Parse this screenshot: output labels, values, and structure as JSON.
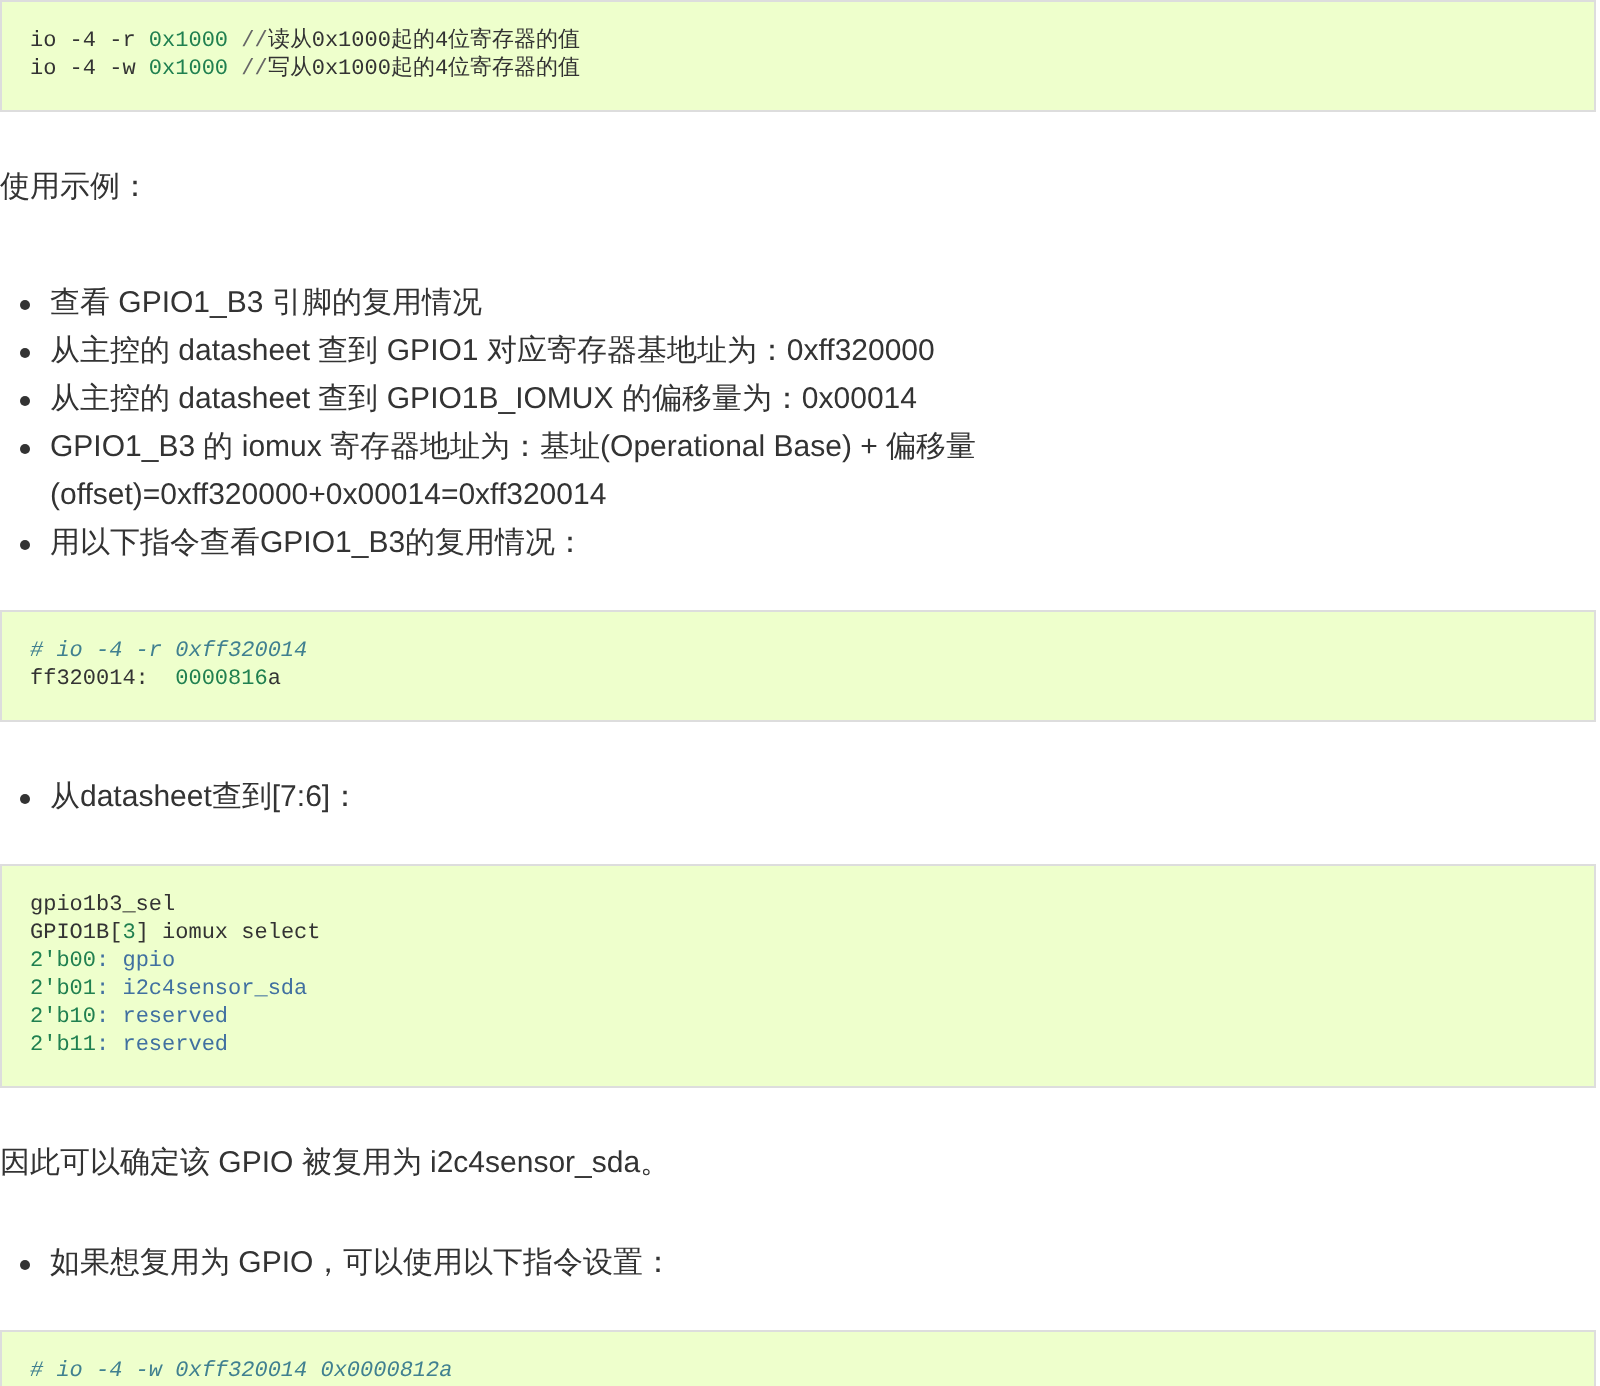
{
  "blocks": [
    {
      "kind": "code",
      "lines": [
        [
          {
            "kind": "plain",
            "text": "io -4 -r "
          },
          {
            "kind": "number",
            "text": "0x1000"
          },
          {
            "kind": "operator",
            "text": " //"
          },
          {
            "kind": "plain",
            "text": "读从0x1000起的4位寄存器的值"
          }
        ],
        [
          {
            "kind": "plain",
            "text": "io -4 -w "
          },
          {
            "kind": "number",
            "text": "0x1000"
          },
          {
            "kind": "operator",
            "text": " //"
          },
          {
            "kind": "plain",
            "text": "写从0x1000起的4位寄存器的值"
          }
        ]
      ]
    },
    {
      "kind": "paragraph",
      "text": "使用示例："
    },
    {
      "kind": "list",
      "items": [
        {
          "text": "查看 GPIO1_B3 引脚的复用情况"
        },
        {
          "text": "从主控的 datasheet 查到 GPIO1 对应寄存器基地址为：0xff320000"
        },
        {
          "text": "从主控的 datasheet 查到 GPIO1B_IOMUX 的偏移量为：0x00014"
        },
        {
          "text": "GPIO1_B3 的 iomux 寄存器地址为：基址(Operational Base) + 偏移量(offset)=0xff320000+0x00014=0xff320014"
        },
        {
          "text": "用以下指令查看GPIO1_B3的复用情况："
        }
      ]
    },
    {
      "kind": "code",
      "lines": [
        [
          {
            "kind": "comment",
            "text": "# io -4 -r 0xff320014"
          }
        ],
        [
          {
            "kind": "plain",
            "text": "ff320014:  "
          },
          {
            "kind": "number",
            "text": "0000816"
          },
          {
            "kind": "plain",
            "text": "a"
          }
        ]
      ]
    },
    {
      "kind": "list",
      "items": [
        {
          "text": "从datasheet查到[7:6]："
        }
      ]
    },
    {
      "kind": "code",
      "lines": [
        [
          {
            "kind": "plain",
            "text": "gpio1b3_sel"
          }
        ],
        [
          {
            "kind": "plain",
            "text": "GPIO1B["
          },
          {
            "kind": "number",
            "text": "3"
          },
          {
            "kind": "plain",
            "text": "] iomux select"
          }
        ],
        [
          {
            "kind": "number",
            "text": "2'b00"
          },
          {
            "kind": "name",
            "text": ": gpio"
          }
        ],
        [
          {
            "kind": "number",
            "text": "2'b01"
          },
          {
            "kind": "name",
            "text": ": i2c4sensor_sda"
          }
        ],
        [
          {
            "kind": "number",
            "text": "2'b10"
          },
          {
            "kind": "name",
            "text": ": reserved"
          }
        ],
        [
          {
            "kind": "number",
            "text": "2'b11"
          },
          {
            "kind": "name",
            "text": ": reserved"
          }
        ]
      ]
    },
    {
      "kind": "paragraph",
      "text": "因此可以确定该 GPIO 被复用为 i2c4sensor_sda。"
    },
    {
      "kind": "list",
      "items": [
        {
          "text": "如果想复用为 GPIO，可以使用以下指令设置："
        }
      ]
    },
    {
      "kind": "code",
      "lines": [
        [
          {
            "kind": "comment",
            "text": "# io -4 -w 0xff320014 0x0000812a"
          }
        ]
      ]
    }
  ]
}
